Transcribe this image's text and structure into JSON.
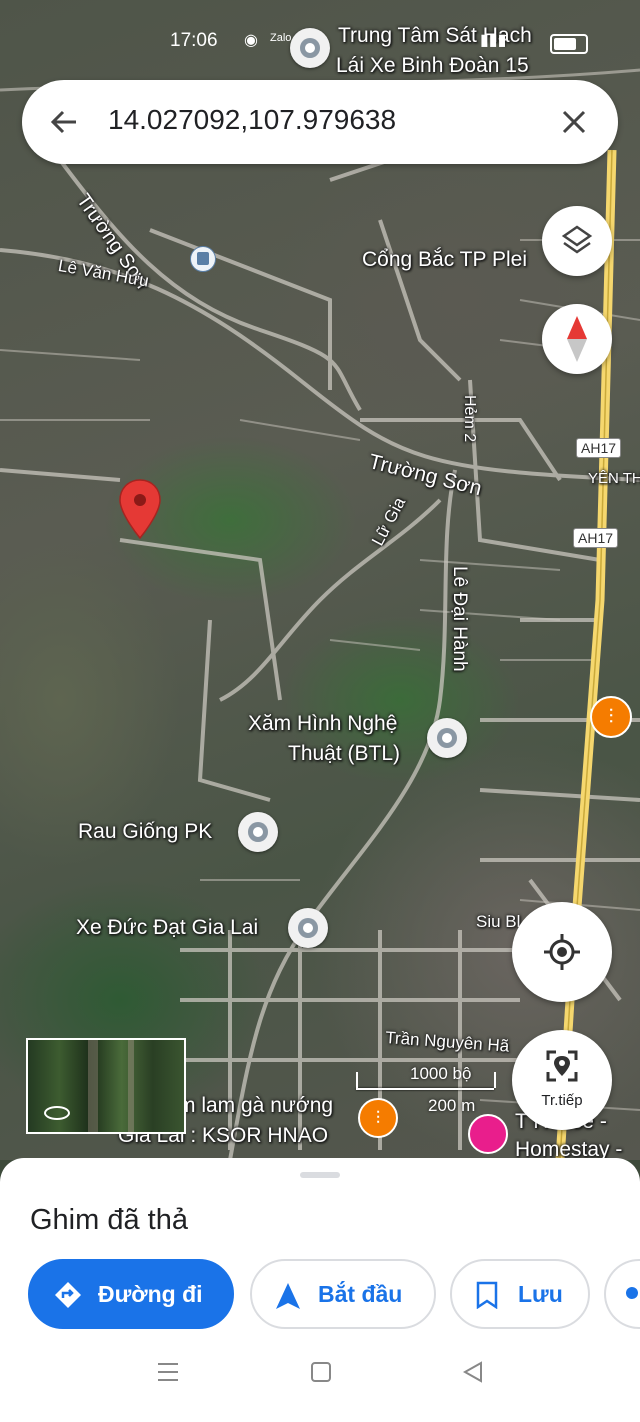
{
  "status_bar": {
    "time": "17:06"
  },
  "search": {
    "value": "14.027092,107.979638"
  },
  "map": {
    "labels": {
      "trung_tam": "Trung Tâm Sát Hạch",
      "trung_tam_2": "Lái Xe Binh Đoàn 15",
      "truong_son_1": "Trường Sơn",
      "le_van_huu": "Lê Văn Hưu",
      "cong_bac": "Cổng Bắc TP Plei",
      "hem2": "Hẻm 2",
      "truong_son_2": "Trường Sơn",
      "yen_the": "YÊN THẾ",
      "lu_gia": "Lữ Gia",
      "le_dai_hanh": "Lê Đại Hành",
      "xam_hinh_1": "Xăm Hình Nghệ",
      "xam_hinh_2": "Thuật (BTL)",
      "rau_giong": "Rau Giống PK",
      "xe_duc_dat": "Xe Đức Đạt Gia Lai",
      "siu_bl": "Siu Bl",
      "tran_nguyen_han": "Trần Nguyên Hã",
      "com_lam_1": "m lam gà nướng",
      "com_lam_2": "Gia Lai : KSOR HNAO",
      "homestay_1": "T  House -",
      "homestay_2": "Homestay -",
      "ah17_a": "AH17",
      "ah17_b": "AH17"
    },
    "scale": {
      "imperial": "1000 bộ",
      "metric": "200 m"
    },
    "street_view_icon": "360-rotate-icon"
  },
  "controls": {
    "layers_icon": "layers-icon",
    "compass_icon": "compass-icon",
    "my_location_icon": "my-location-icon",
    "directions_label": "Tr.tiếp"
  },
  "sheet": {
    "title": "Ghim đã thả",
    "buttons": {
      "directions": "Đường đi",
      "start": "Bắt đầu",
      "save": "Lưu"
    }
  },
  "colors": {
    "accent": "#1a73e8",
    "pin": "#e53935",
    "highway": "#f5d76e"
  }
}
